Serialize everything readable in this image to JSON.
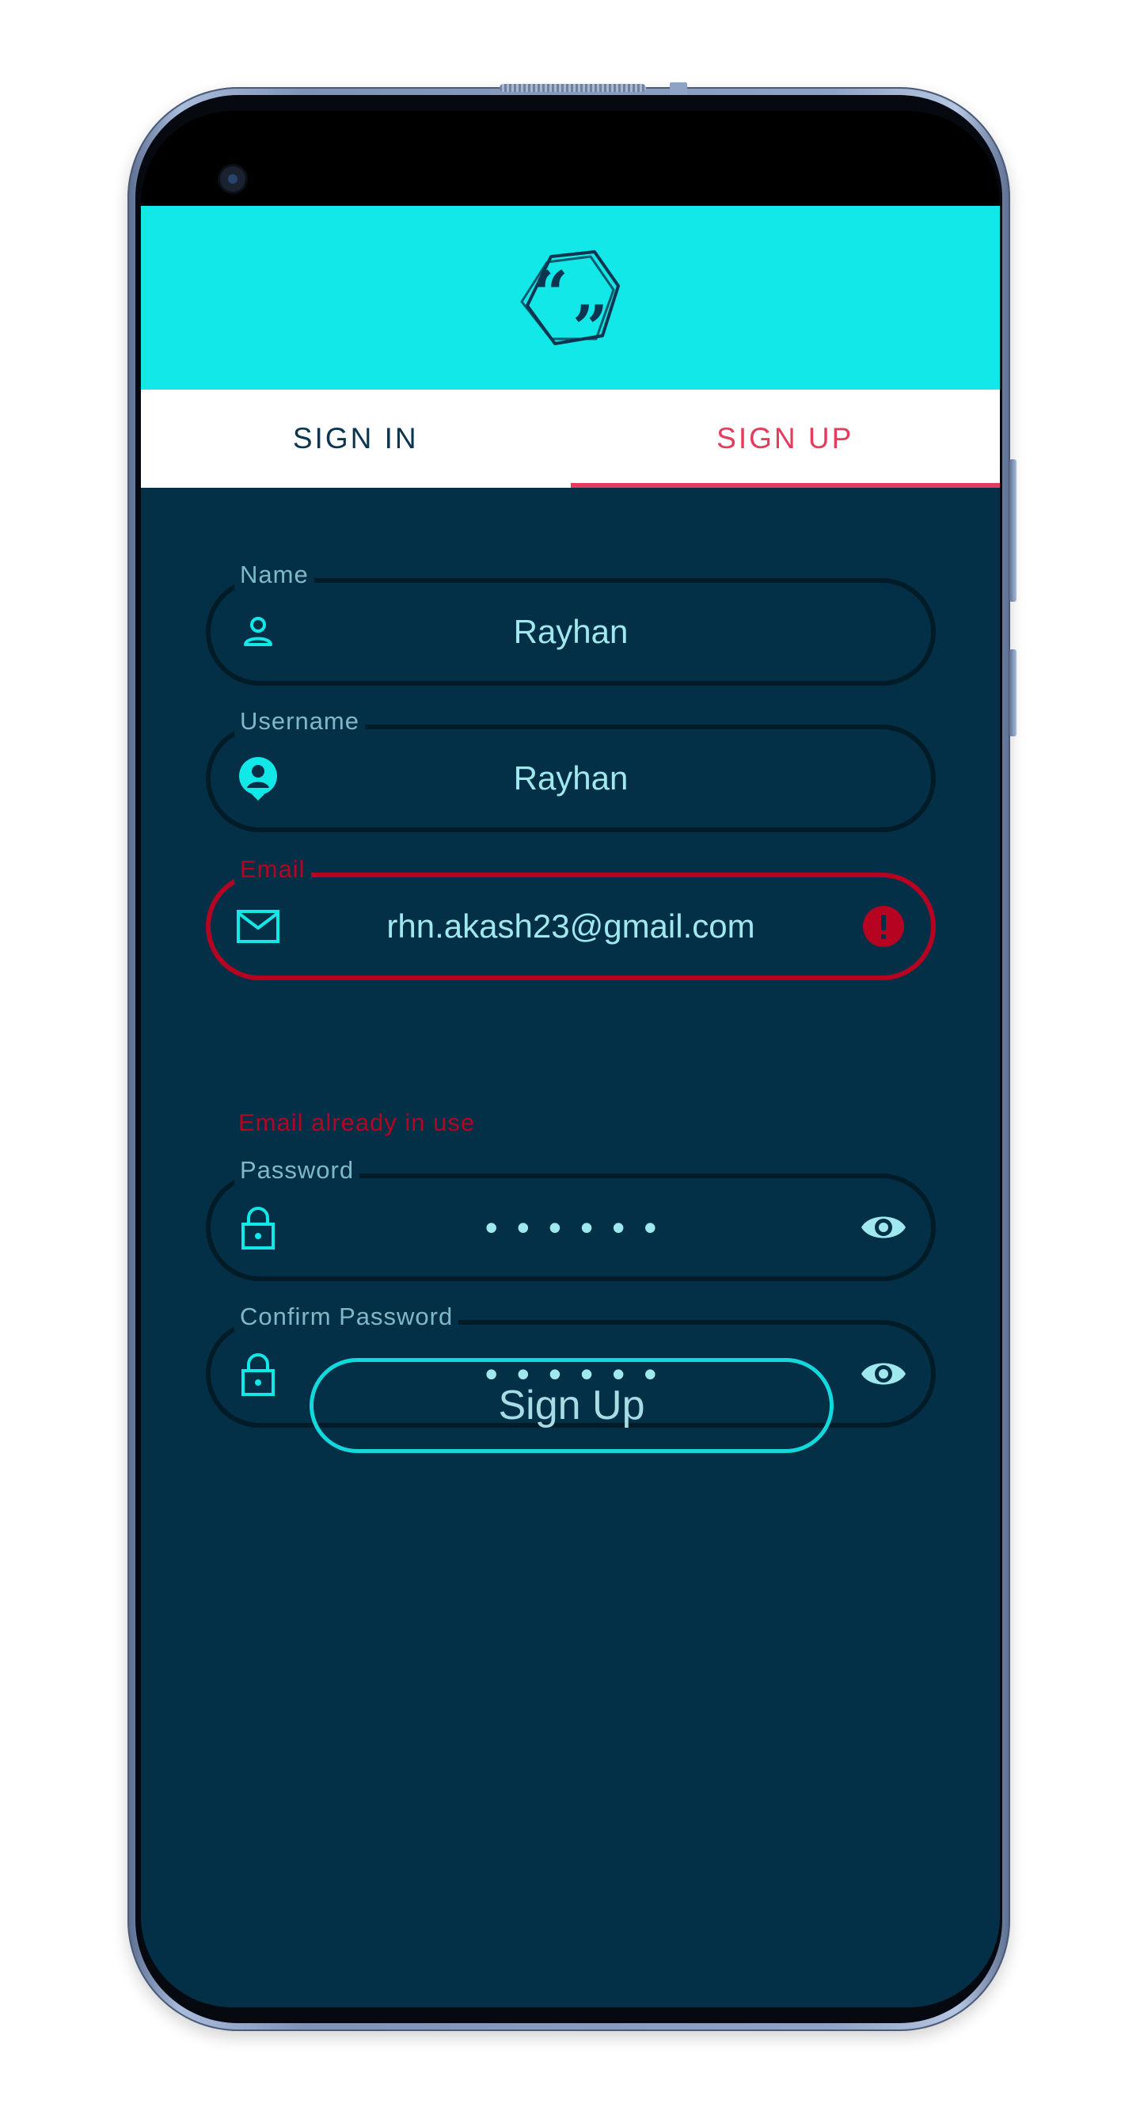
{
  "tabs": [
    {
      "label": "SIGN IN",
      "active": false
    },
    {
      "label": "SIGN UP",
      "active": true
    }
  ],
  "form": {
    "name": {
      "label": "Name",
      "value": "Rayhan",
      "icon": "person-icon"
    },
    "username": {
      "label": "Username",
      "value": "Rayhan",
      "icon": "account-circle-icon"
    },
    "email": {
      "label": "Email",
      "value": "rhn.akash23@gmail.com",
      "icon": "mail-icon",
      "error": "Email already in use",
      "trailing_icon": "error-icon"
    },
    "password": {
      "label": "Password",
      "value": "••••••",
      "icon": "lock-icon",
      "trailing_icon": "eye-icon"
    },
    "confirm_password": {
      "label": "Confirm Password",
      "value": "••••••",
      "icon": "lock-icon",
      "trailing_icon": "eye-icon"
    }
  },
  "submit_label": "Sign Up",
  "colors": {
    "header": "#12e8e7",
    "background": "#033047",
    "accent": "#e53c5d",
    "error": "#b60322",
    "button_border": "#12d9dc"
  }
}
